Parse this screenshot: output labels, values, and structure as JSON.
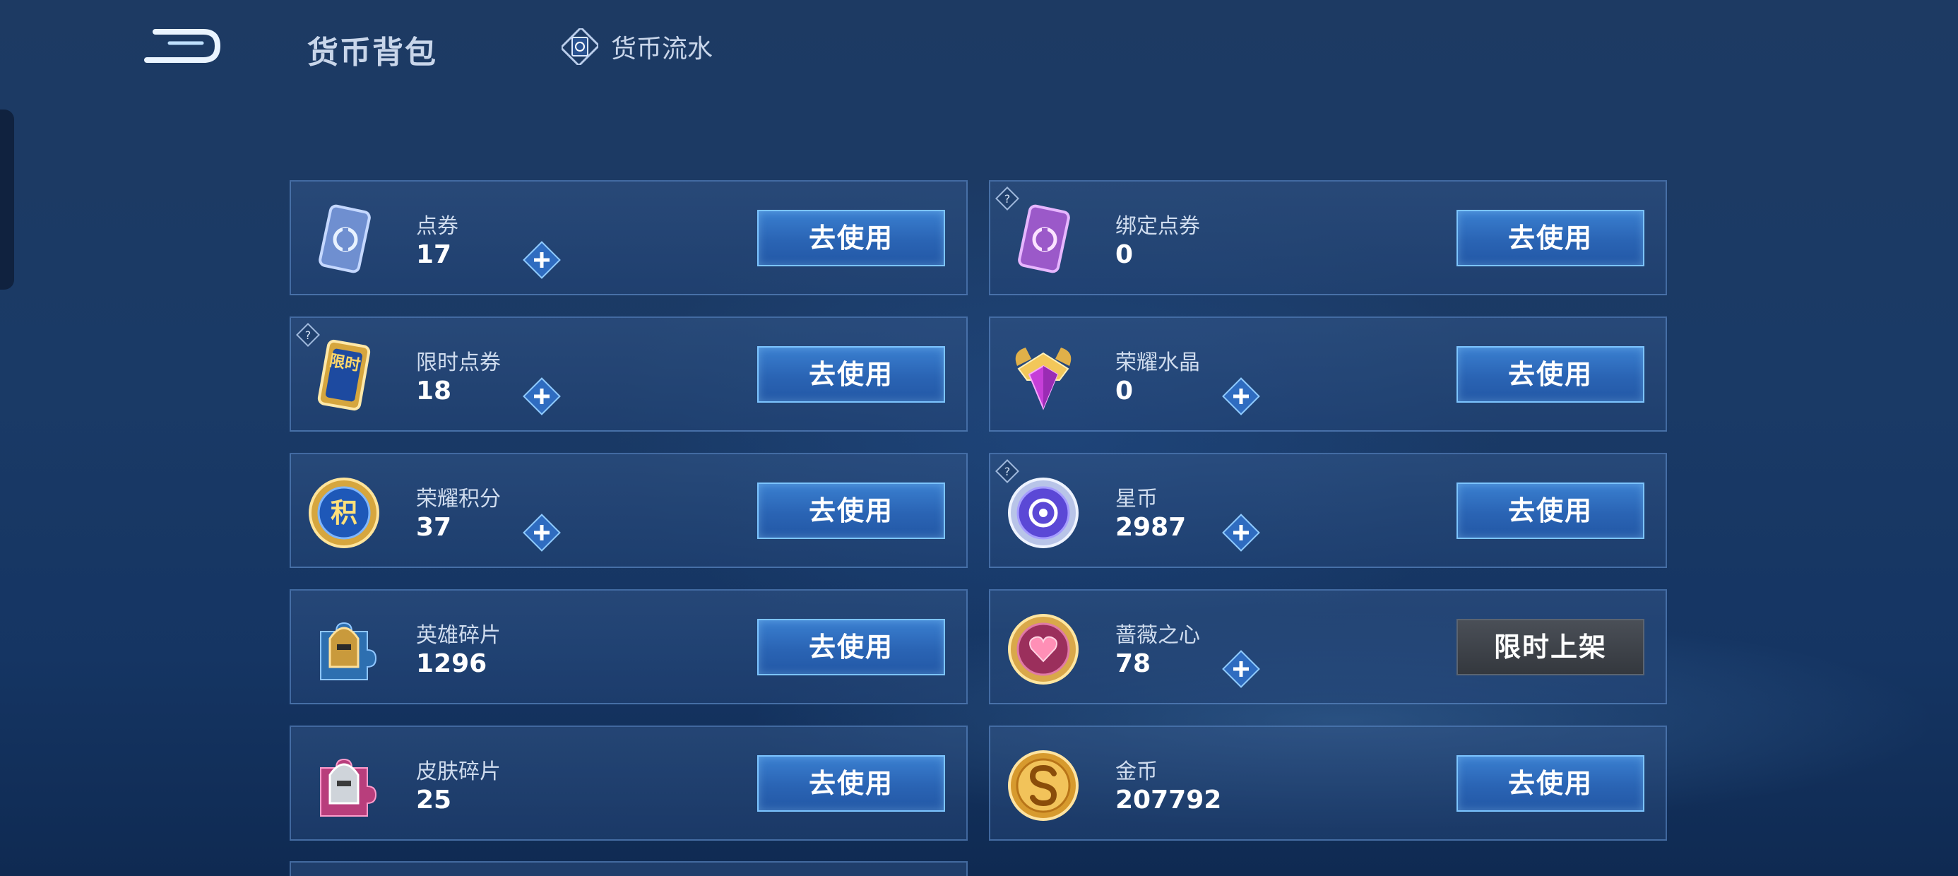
{
  "header": {
    "title": "货币背包",
    "flow_link": "货币流水"
  },
  "currencies": [
    {
      "name": "点券",
      "value": "17",
      "button": "去使用",
      "icon": "coupon-icon"
    },
    {
      "name": "绑定点券",
      "value": "0",
      "button": "去使用",
      "icon": "bound-coupon-icon"
    },
    {
      "name": "限时点券",
      "value": "18",
      "button": "去使用",
      "icon": "limited-coupon-icon",
      "icon_text": "限时"
    },
    {
      "name": "荣耀水晶",
      "value": "0",
      "button": "去使用",
      "icon": "glory-crystal-icon"
    },
    {
      "name": "荣耀积分",
      "value": "37",
      "button": "去使用",
      "icon": "glory-points-icon",
      "icon_text": "积"
    },
    {
      "name": "星币",
      "value": "2987",
      "button": "去使用",
      "icon": "star-coin-icon"
    },
    {
      "name": "英雄碎片",
      "value": "1296",
      "button": "去使用",
      "icon": "hero-fragment-icon"
    },
    {
      "name": "蔷薇之心",
      "value": "78",
      "button": "限时上架",
      "icon": "rose-heart-icon"
    },
    {
      "name": "皮肤碎片",
      "value": "25",
      "button": "去使用",
      "icon": "skin-fragment-icon"
    },
    {
      "name": "金币",
      "value": "207792",
      "button": "去使用",
      "icon": "gold-coin-icon"
    }
  ],
  "colors": {
    "accent": "#2a64b4",
    "button_border": "#7cc4ff",
    "disabled_button": "#3a3e44"
  }
}
